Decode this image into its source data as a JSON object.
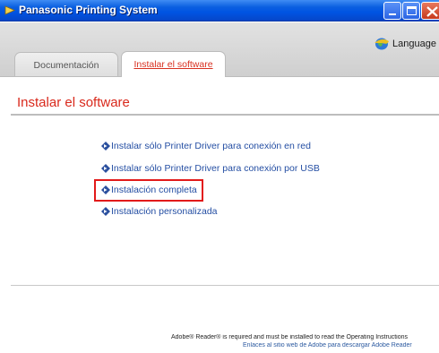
{
  "window": {
    "title": "Panasonic Printing System"
  },
  "header": {
    "language_label": "Language",
    "tabs": [
      {
        "label": "Documentación",
        "active": false
      },
      {
        "label": "Instalar el software",
        "active": true
      }
    ]
  },
  "main": {
    "section_title": "Instalar el software",
    "options": [
      {
        "label": "Instalar sólo Printer Driver para conexión en red",
        "highlighted": false
      },
      {
        "label": "Instalar sólo Printer Driver para conexión por USB",
        "highlighted": false
      },
      {
        "label": "Instalación completa",
        "highlighted": true
      },
      {
        "label": "Instalación personalizada",
        "highlighted": false
      }
    ]
  },
  "footer": {
    "notice": "Adobe® Reader® is required and must be installed to read the Operating Instructions",
    "link": "Enlaces al sitio web de Adobe para descargar Adobe Reader"
  },
  "colors": {
    "titlebar": "#0054e3",
    "accent_red": "#d9291c",
    "link_blue": "#244ea3",
    "highlight_border": "#e21a1a"
  },
  "icons": {
    "title": "app-icon",
    "language": "globe-icon",
    "option": "diamond-arrow-icon"
  }
}
